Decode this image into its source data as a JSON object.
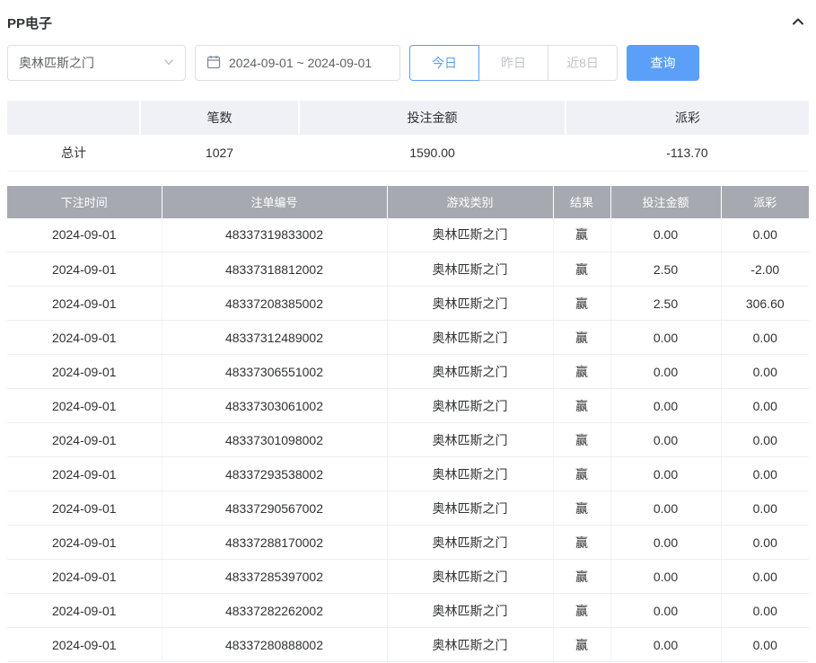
{
  "header": {
    "title": "PP电子",
    "collapse_icon": "chevron-up-icon"
  },
  "filters": {
    "game_select": {
      "value": "奥林匹斯之门",
      "caret_icon": "chevron-down-icon"
    },
    "date_range": {
      "value": "2024-09-01 ~ 2024-09-01",
      "icon": "calendar-icon"
    },
    "quick_buttons": [
      {
        "label": "今日",
        "active": true
      },
      {
        "label": "昨日",
        "active": false
      },
      {
        "label": "近8日",
        "active": false
      }
    ],
    "query_button_label": "查询"
  },
  "summary": {
    "columns": [
      "",
      "笔数",
      "投注金额",
      "派彩"
    ],
    "row": {
      "label": "总计",
      "count": "1027",
      "bet_amount": "1590.00",
      "payout": "-113.70"
    }
  },
  "table": {
    "columns": [
      "下注时间",
      "注单编号",
      "游戏类别",
      "结果",
      "投注金额",
      "派彩"
    ],
    "rows": [
      [
        "2024-09-01",
        "48337319833002",
        "奥林匹斯之门",
        "赢",
        "0.00",
        "0.00"
      ],
      [
        "2024-09-01",
        "48337318812002",
        "奥林匹斯之门",
        "赢",
        "2.50",
        "-2.00"
      ],
      [
        "2024-09-01",
        "48337208385002",
        "奥林匹斯之门",
        "赢",
        "2.50",
        "306.60"
      ],
      [
        "2024-09-01",
        "48337312489002",
        "奥林匹斯之门",
        "赢",
        "0.00",
        "0.00"
      ],
      [
        "2024-09-01",
        "48337306551002",
        "奥林匹斯之门",
        "赢",
        "0.00",
        "0.00"
      ],
      [
        "2024-09-01",
        "48337303061002",
        "奥林匹斯之门",
        "赢",
        "0.00",
        "0.00"
      ],
      [
        "2024-09-01",
        "48337301098002",
        "奥林匹斯之门",
        "赢",
        "0.00",
        "0.00"
      ],
      [
        "2024-09-01",
        "48337293538002",
        "奥林匹斯之门",
        "赢",
        "0.00",
        "0.00"
      ],
      [
        "2024-09-01",
        "48337290567002",
        "奥林匹斯之门",
        "赢",
        "0.00",
        "0.00"
      ],
      [
        "2024-09-01",
        "48337288170002",
        "奥林匹斯之门",
        "赢",
        "0.00",
        "0.00"
      ],
      [
        "2024-09-01",
        "48337285397002",
        "奥林匹斯之门",
        "赢",
        "0.00",
        "0.00"
      ],
      [
        "2024-09-01",
        "48337282262002",
        "奥林匹斯之门",
        "赢",
        "0.00",
        "0.00"
      ],
      [
        "2024-09-01",
        "48337280888002",
        "奥林匹斯之门",
        "赢",
        "0.00",
        "0.00"
      ]
    ]
  },
  "colors": {
    "primary": "#5b9ff8",
    "negative": "#f56c6c",
    "table_header_bg": "#a7a9b0",
    "summary_header_bg": "#eff1f6"
  }
}
